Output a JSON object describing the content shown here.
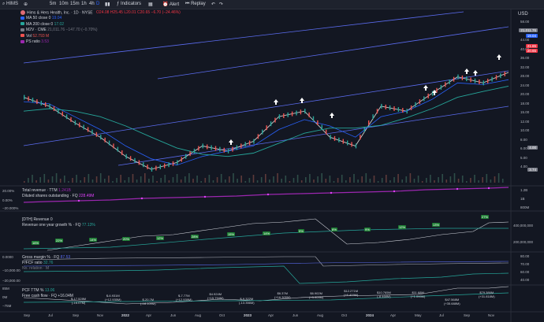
{
  "toolbar": {
    "symbol": "HIMS",
    "intervals": [
      "5m",
      "10m",
      "15m",
      "1h",
      "4h"
    ],
    "active_interval": "D",
    "indicators_label": "Indicators",
    "alert_label": "Alert",
    "replay_label": "Replay",
    "currency": "USD"
  },
  "legend": {
    "title": "Hims & Hers Health, Inc. · 1D · NYSE",
    "ohlc": "O24.08 H25.45 L20.01 C20.65 −6.70 (−24.46%)",
    "items": [
      {
        "label": "MA 50 close 0",
        "value": "19.04",
        "color": "#2962ff"
      },
      {
        "label": "MA 200 close 0",
        "value": "17.02",
        "color": "#26a69a"
      },
      {
        "label": "M2V · CME",
        "value": "21,011.76 −147.70 (−0.70%)",
        "color": "#787b86"
      },
      {
        "label": "Vol",
        "value": "52.793 M",
        "color": "#ef5350"
      },
      {
        "label": "PS ratio",
        "value": "3.53",
        "color": "#9c27b0"
      }
    ]
  },
  "price_axis": {
    "ticks": [
      "58.00",
      "52.00",
      "44.00",
      "40.00",
      "36.00",
      "32.00",
      "28.00",
      "24.00",
      "20.00",
      "18.00",
      "15.00",
      "12.00",
      "10.00",
      "8.00",
      "6.00",
      "5.00",
      "4.00"
    ],
    "badges": [
      {
        "value": "21,011.76",
        "color": "#787b86"
      },
      {
        "value": "19.04",
        "color": "#2962ff"
      },
      {
        "value": "21.65",
        "color": "#f23645"
      },
      {
        "value": "20.65",
        "color": "#f23645"
      },
      {
        "value": "4.00",
        "color": "#787b86"
      },
      {
        "value": "3.74",
        "color": "#787b86"
      }
    ]
  },
  "revenue_pane": {
    "label": "Total revenue · TTM",
    "value": "1.241B",
    "label2": "Diluted shares outstanding · FQ",
    "value2": "228.49M",
    "ticks": [
      "20.00%",
      "0.00%",
      "−20.000%"
    ],
    "right_ticks": [
      "1.2B",
      "1B",
      "800M"
    ]
  },
  "growth_pane": {
    "label": "[DTH] Revenue 0",
    "sub_label": "Revenue one year growth % · FQ",
    "value": "77.13%",
    "growth_values": [
      "16%",
      "22%",
      "14%",
      "20%",
      "12%",
      "28%",
      "15%",
      "14%",
      "9%",
      "8%",
      "9%",
      "12%",
      "13%",
      "27%"
    ],
    "right_ticks": [
      "400,000,000",
      "200,000,000"
    ]
  },
  "margin_pane": {
    "label": "Gross margin % · FQ",
    "value": "87.53",
    "label2": "P/FCF ratio",
    "value2": "32.76",
    "label3": "No. relation · M",
    "ticks": [
      "0.0000",
      "−10,000.00",
      "−20,000.00"
    ],
    "right_ticks": [
      "80.00",
      "70.00",
      "60.00",
      "40.00"
    ]
  },
  "fcf_pane": {
    "label": "PCF TTM %",
    "value": "13.06",
    "sub_label": "Free cash flow · FQ",
    "value2": "+16.04M",
    "ticks": [
      "85M",
      "0M",
      "−75M"
    ],
    "values": [
      {
        "a": "$-17.528M",
        "b": "(-16.07M)"
      },
      {
        "a": "$-6.931M",
        "b": "(+12.935M)"
      },
      {
        "a": "$-20.7M",
        "b": "(-18.109M)"
      },
      {
        "a": "$-7.77M",
        "b": "(+12.939M)"
      },
      {
        "a": "$4.924M",
        "b": "(+15.794M)"
      },
      {
        "a": "$-9.322M",
        "b": "(-13.356M)"
      },
      {
        "a": "$6.37M",
        "b": "(+16.305M)"
      },
      {
        "a": "$6.902M",
        "b": "(+3.909M)"
      },
      {
        "a": "$12.271M",
        "b": "(+6.409M)"
      },
      {
        "a": "$10.765M",
        "b": "(-8.468M)"
      },
      {
        "a": "$11.68M",
        "b": "(+1.095M)"
      },
      {
        "a": "$47.568M",
        "b": "(+35.688M)"
      },
      {
        "a": "$79.386M",
        "b": "(+31.818M)"
      }
    ]
  },
  "dates": [
    "Sep",
    "Jul",
    "Sep",
    "Nov",
    "2022",
    "Apr",
    "Jun",
    "Aug",
    "Oct",
    "2023",
    "Apr",
    "Jun",
    "Aug",
    "Oct",
    "2024",
    "Apr",
    "May",
    "Jul",
    "Sep",
    "Nov"
  ],
  "chart_data": {
    "type": "line",
    "title": "Hims & Hers Health, Inc. · 1D · NYSE",
    "x": [
      "2021-05",
      "2021-07",
      "2021-09",
      "2021-11",
      "2022-01",
      "2022-04",
      "2022-06",
      "2022-08",
      "2022-10",
      "2023-01",
      "2023-04",
      "2023-06",
      "2023-08",
      "2023-10",
      "2024-01",
      "2024-04",
      "2024-05",
      "2024-07",
      "2024-09",
      "2024-11"
    ],
    "series": [
      {
        "name": "HIMS",
        "values": [
          14,
          12,
          9,
          7,
          5,
          4,
          4.5,
          6,
          5.5,
          6.5,
          10,
          11,
          7,
          6,
          12,
          11,
          15,
          20,
          18,
          21.65
        ]
      },
      {
        "name": "MA 50",
        "values": [
          13,
          12.5,
          10,
          8,
          6,
          4.8,
          4.3,
          5,
          5.5,
          6,
          8,
          9.5,
          8.5,
          7,
          10,
          11,
          13.5,
          18,
          17.5,
          19.04
        ]
      },
      {
        "name": "MA 200",
        "values": [
          11,
          11.5,
          11,
          10,
          8.5,
          7,
          5.8,
          5.2,
          5,
          5.3,
          6.3,
          7.5,
          8.2,
          8.2,
          8.6,
          9.8,
          11.5,
          14,
          15.5,
          17.02
        ]
      }
    ],
    "ylim": [
      4,
      58
    ]
  }
}
